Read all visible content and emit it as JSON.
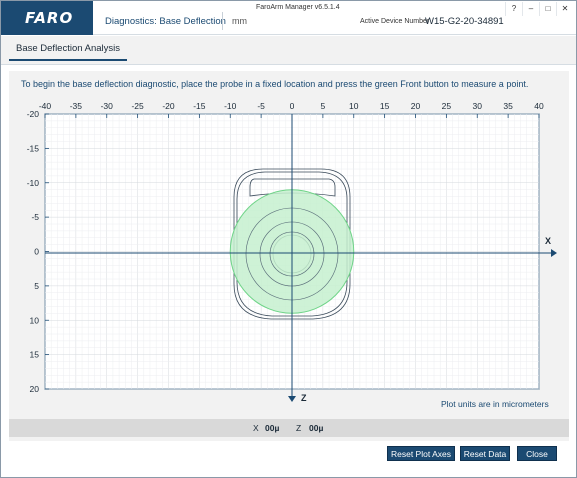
{
  "app": {
    "logo": "FARO",
    "title": "FaroArm Manager v6.5.1.4",
    "diag_title": "Diagnostics: Base Deflection",
    "units": "mm",
    "active_device_label": "Active Device Number",
    "device_number": "W15-G2-20-34891"
  },
  "window_controls": {
    "help": "?",
    "minimize": "–",
    "maximize": "□",
    "close": "✕"
  },
  "tabs": [
    {
      "label": "Base Deflection Analysis",
      "active": true
    }
  ],
  "instructions": "To begin the base deflection diagnostic, place the probe in a fixed location and press the green Front button to measure a point.",
  "plot": {
    "x_axis_label": "X",
    "z_axis_label": "Z",
    "x_ticks": [
      "-40",
      "-35",
      "-30",
      "-25",
      "-20",
      "-15",
      "-10",
      "-5",
      "0",
      "5",
      "10",
      "15",
      "20",
      "25",
      "30",
      "35",
      "40"
    ],
    "y_ticks": [
      "-20",
      "-15",
      "-10",
      "-5",
      "0",
      "5",
      "10",
      "15",
      "20"
    ],
    "xlim": [
      -40,
      40
    ],
    "ylim": [
      -20,
      20
    ],
    "circle_radius": 10,
    "circle_fill": "#c6f0cf",
    "circle_stroke": "#6fd488",
    "axis_color": "#1b4a72",
    "units_note": "Plot units are in micrometers"
  },
  "readout": {
    "x_label": "X",
    "x_value": "00µ",
    "z_label": "Z",
    "z_value": "00µ"
  },
  "buttons": {
    "reset_axes": "Reset Plot Axes",
    "reset_data": "Reset Data",
    "close": "Close"
  }
}
